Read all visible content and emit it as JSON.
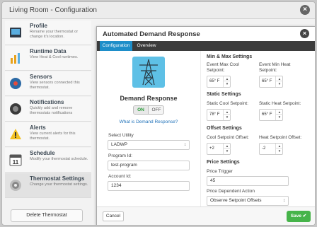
{
  "window": {
    "title": "Living Room - Configuration",
    "close": "×"
  },
  "sidebar": {
    "items": [
      {
        "title": "Profile",
        "sub": "Rename your thermostat or change it's location."
      },
      {
        "title": "Runtime Data",
        "sub": "View Heat & Cool runtimes."
      },
      {
        "title": "Sensors",
        "sub": "View sensors connected this thermostat."
      },
      {
        "title": "Notifications",
        "sub": "Quickly add and remove thermostats notifications"
      },
      {
        "title": "Alerts",
        "sub": "View current alerts for this thermostat."
      },
      {
        "title": "Schedule",
        "sub": "Modify your thermostat schedule."
      },
      {
        "title": "Thermostat Settings",
        "sub": "Change your thermostat settings."
      }
    ],
    "schedule_icon_text": "11",
    "delete_label": "Delete Thermostat"
  },
  "modal": {
    "title": "Automated Demand Response",
    "close": "×",
    "tabs": [
      "Configuration",
      "Overview"
    ],
    "heading": "Demand Response",
    "toggle_on": "ON",
    "toggle_off": "OFF",
    "toggle_state": "ON",
    "link": "What is Demand Response?",
    "utility": {
      "label": "Select Utility",
      "value": "LADWP",
      "arrow": "↕"
    },
    "program_id": {
      "label": "Program Id:",
      "value": "test-program"
    },
    "account_id": {
      "label": "Account Id:",
      "value": "1234"
    },
    "minmax": {
      "title": "Min & Max Settings",
      "max_cool_label": "Event Max Cool Setpoint:",
      "max_cool_value": "65° F",
      "min_heat_label": "Event Min Heat Setpoint:",
      "min_heat_value": "65° F"
    },
    "static": {
      "title": "Static Settings",
      "cool_label": "Static Cool Setpoint:",
      "cool_value": "78° F",
      "heat_label": "Static Heat Setpoint:",
      "heat_value": "65° F"
    },
    "offset": {
      "title": "Offset Settings",
      "cool_label": "Cool Setpoint Offset:",
      "cool_value": "+2",
      "heat_label": "Heat Setpoint Offset:",
      "heat_value": "-2"
    },
    "price": {
      "title": "Price Settings",
      "trigger_label": "Price Trigger",
      "trigger_value": "45",
      "action_label": "Price Dependent Action",
      "action_value": "Observe Setpoint Offsets",
      "action_arrow": "↕"
    },
    "stepper_up": "▲",
    "stepper_down": "▼",
    "cancel": "Cancel",
    "save": "Save ✔"
  },
  "colors": {
    "accent_blue": "#1e8ec9",
    "save_green": "#46b44a",
    "tower_bg": "#5ec0e6",
    "tabbar": "#3b3b3b"
  }
}
